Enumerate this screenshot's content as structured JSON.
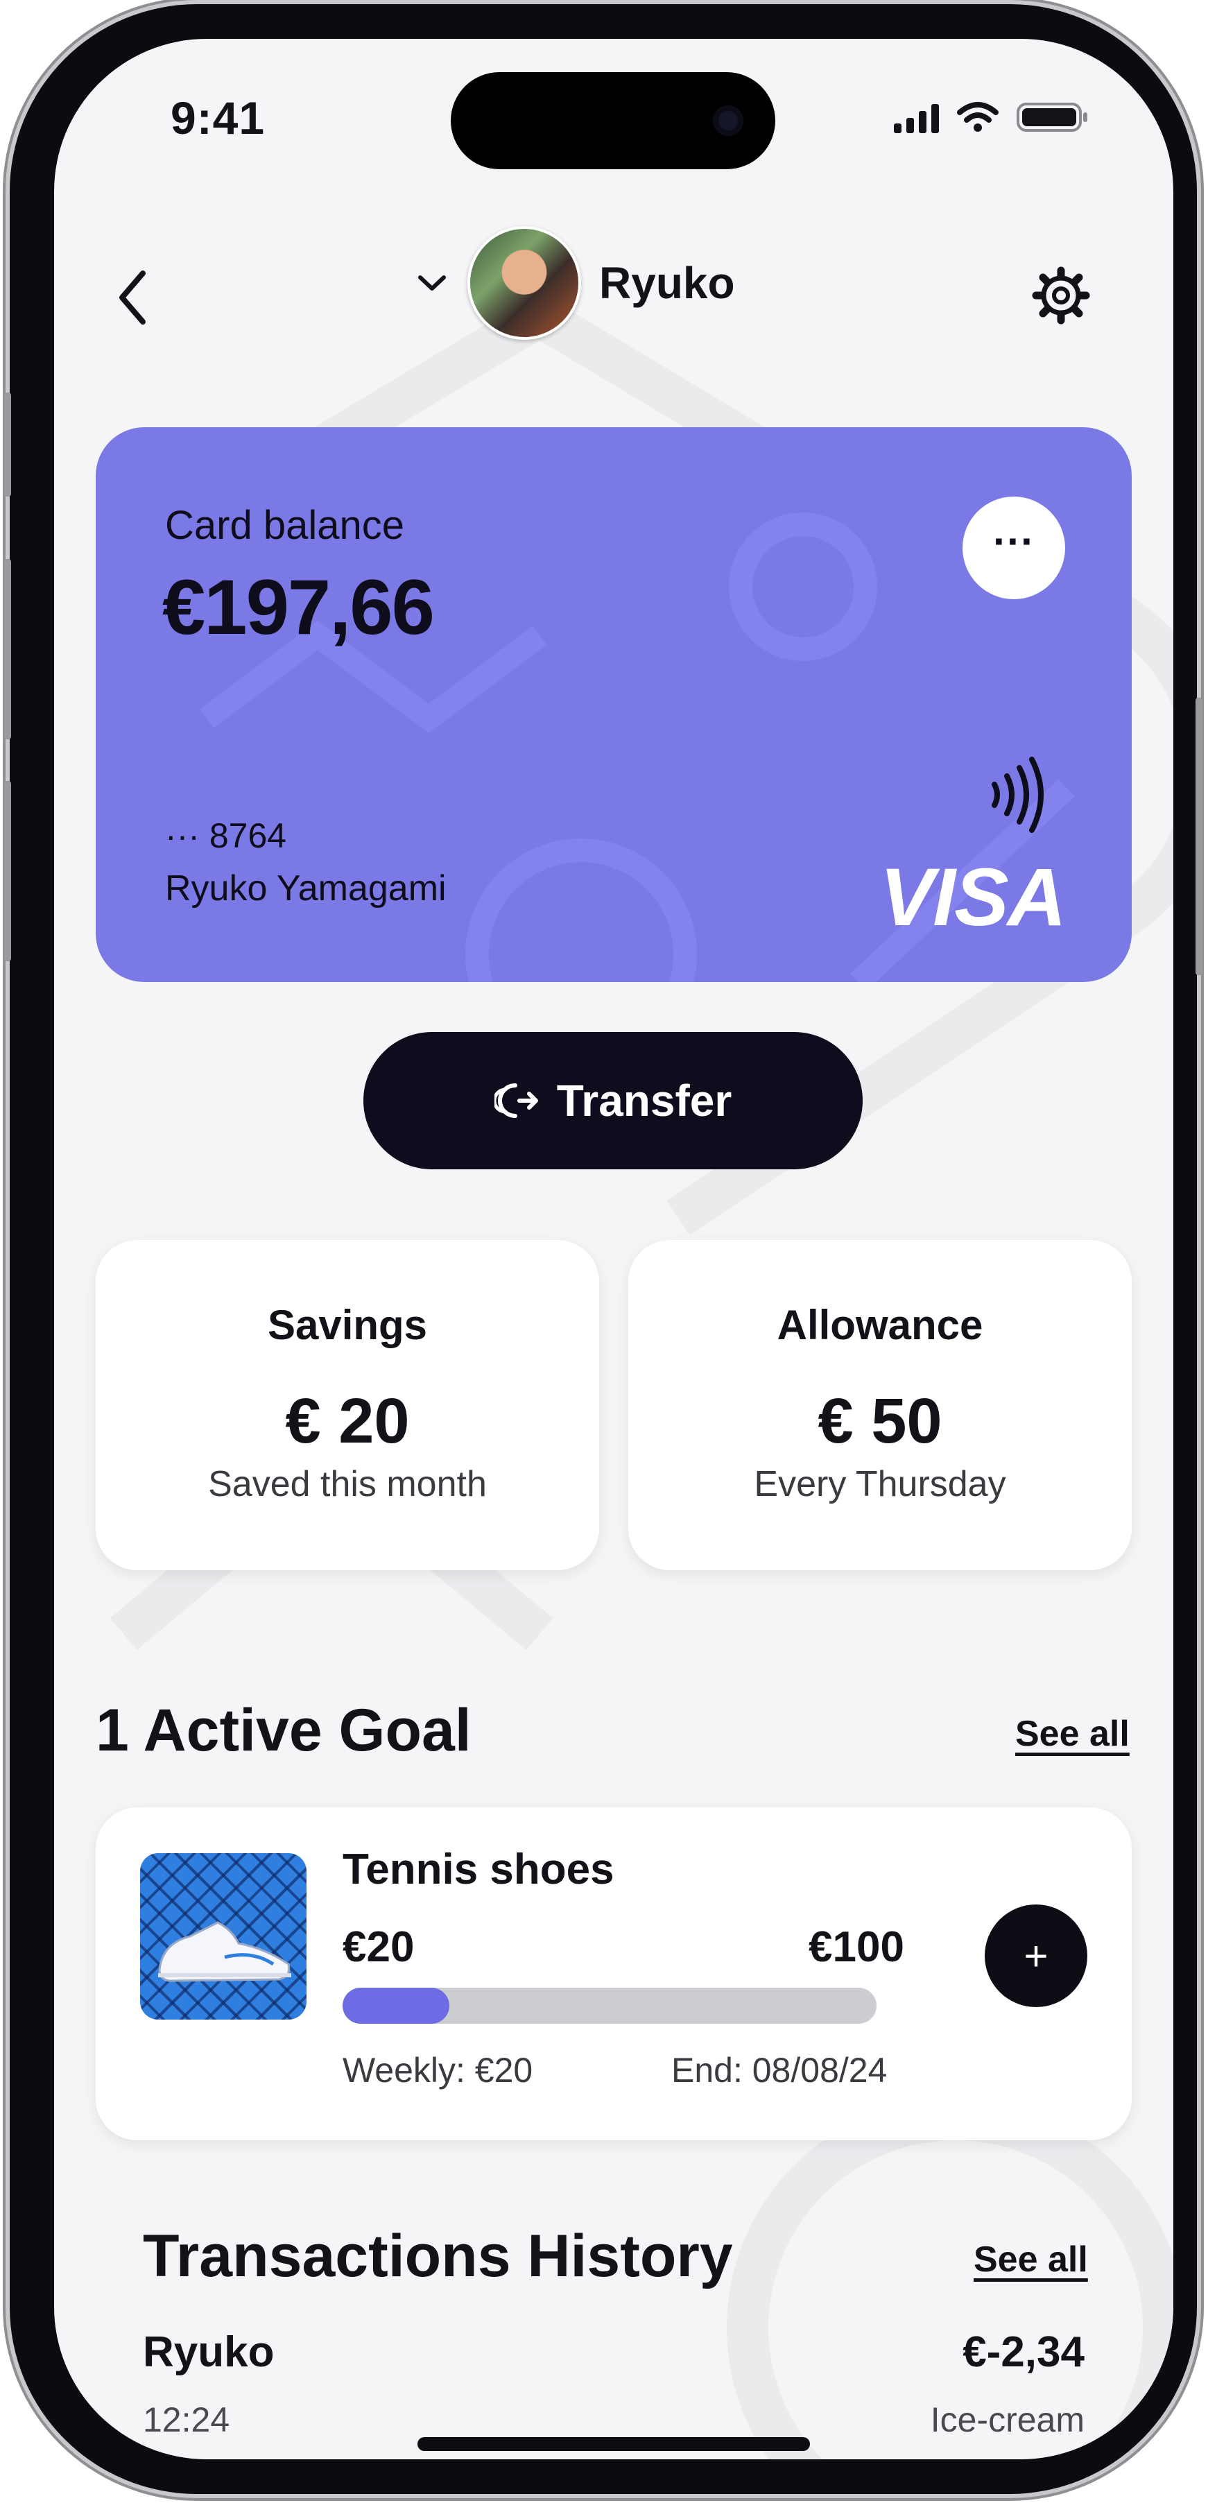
{
  "status_bar": {
    "time": "9:41"
  },
  "header": {
    "profile_name": "Ryuko"
  },
  "card": {
    "balance_label": "Card balance",
    "balance": "€197,66",
    "more_label": "···",
    "number_masked": "··· 8764",
    "holder": "Ryuko Yamagami",
    "network": "VISA",
    "color": "#7b79e6"
  },
  "transfer": {
    "label": "Transfer"
  },
  "stats": [
    {
      "title": "Savings",
      "value": "€ 20",
      "caption": "Saved this month"
    },
    {
      "title": "Allowance",
      "value": "€ 50",
      "caption": "Every Thursday"
    }
  ],
  "goals": {
    "heading": "1 Active Goal",
    "see_all": "See all",
    "items": [
      {
        "name": "Tennis shoes",
        "current": "€20",
        "target": "€100",
        "progress": 0.2,
        "weekly": "Weekly: €20",
        "end": "End: 08/08/24",
        "add_label": "+"
      }
    ]
  },
  "transactions": {
    "heading": "Transactions History",
    "see_all": "See all",
    "items": [
      {
        "name": "Ryuko",
        "amount": "€-2,34",
        "time": "12:24",
        "description": "Ice-cream"
      }
    ]
  },
  "icons": {
    "back": "chevron-left-icon",
    "profile_switch": "chevron-down-icon",
    "settings": "gear-icon",
    "contactless": "contactless-icon",
    "transfer": "transfer-icon",
    "add": "plus-icon"
  },
  "colors": {
    "accent": "#6f6be5",
    "dark": "#100b1d",
    "background": "#f5f5f7"
  }
}
